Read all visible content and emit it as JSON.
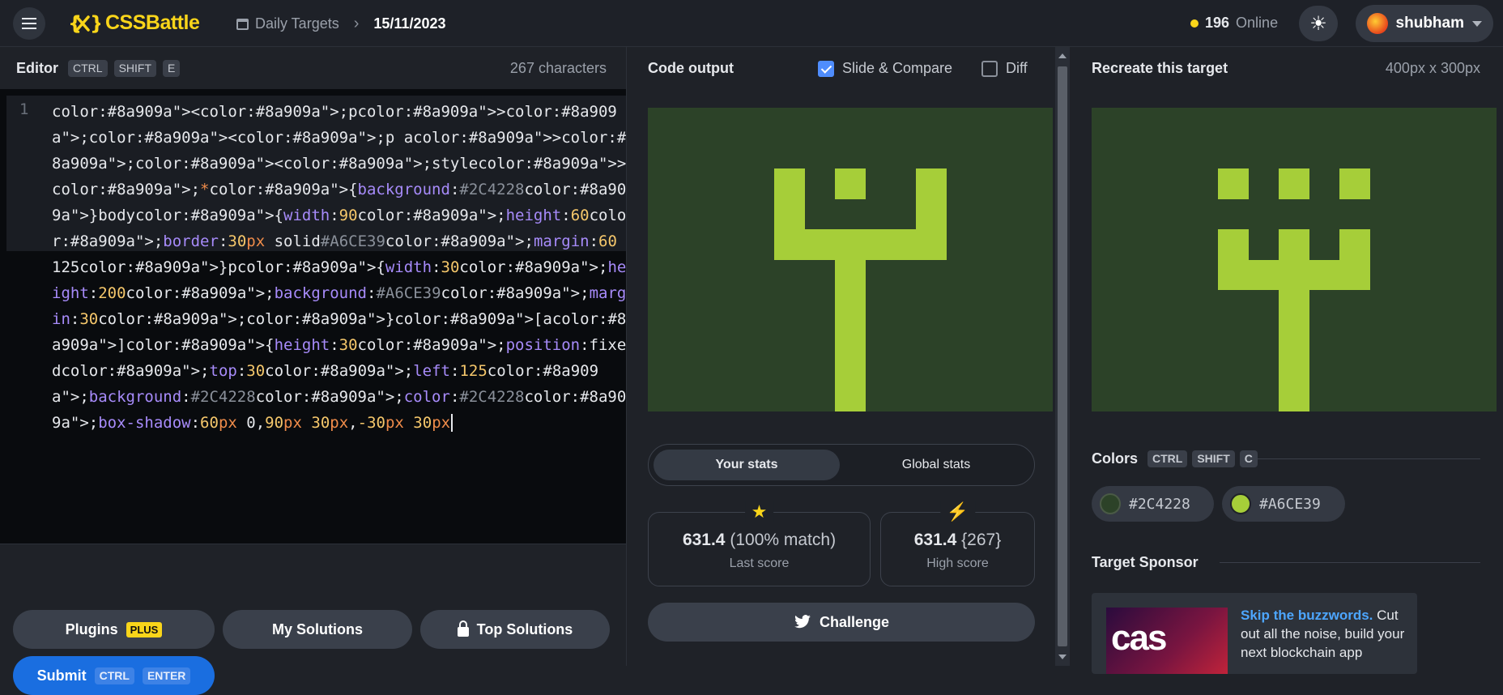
{
  "header": {
    "logo_text": "CSSBattle",
    "breadcrumb_section": "Daily Targets",
    "breadcrumb_date": "15/11/2023",
    "online_count": "196",
    "online_label": "Online",
    "username": "shubham"
  },
  "editor": {
    "title": "Editor",
    "shortcut": [
      "CTRL",
      "SHIFT",
      "E"
    ],
    "char_count": "267 characters",
    "line_number": "1",
    "code": "<p><p a><style>*{background:#2C4228}body{width:90;height:60;border:30px solid#A6CE39;margin:60 125}p{width:30;height:200;background:#A6CE39;margin:30;}[a]{height:30;position:fixed;top:30;left:125;background:#2C4228;color:#2C4228;box-shadow:60px 0,90px 30px,-30px 30px"
  },
  "actions": {
    "plugins_label": "Plugins",
    "plugins_badge": "PLUS",
    "my_solutions_label": "My Solutions",
    "top_solutions_label": "Top Solutions",
    "submit_label": "Submit",
    "submit_shortcut": [
      "CTRL",
      "ENTER"
    ]
  },
  "output": {
    "title": "Code output",
    "slide_compare_label": "Slide & Compare",
    "slide_compare_checked": true,
    "diff_label": "Diff",
    "diff_checked": false
  },
  "stats": {
    "tab_yours": "Your stats",
    "tab_global": "Global stats",
    "last_score_value": "631.4",
    "last_score_match": "(100% match)",
    "last_score_label": "Last score",
    "high_score_value": "631.4",
    "high_score_chars": "{267}",
    "high_score_label": "High score",
    "challenge_label": "Challenge"
  },
  "target": {
    "title": "Recreate this target",
    "size": "400px x 300px",
    "colors_title": "Colors",
    "colors_shortcut": [
      "CTRL",
      "SHIFT",
      "C"
    ],
    "colors": [
      {
        "hex": "#2C4228",
        "label": "#2C4228"
      },
      {
        "hex": "#A6CE39",
        "label": "#A6CE39"
      }
    ],
    "sponsor_title": "Target Sponsor",
    "sponsor_image_text": "cas",
    "sponsor_highlight": "Skip the buzzwords.",
    "sponsor_text": "Cut out all the noise, build your next blockchain app"
  },
  "colors": {
    "brand_yellow": "#f9d51a",
    "background": "#2C4228",
    "foreground": "#A6CE39",
    "submit_blue": "#1a6ee0"
  }
}
